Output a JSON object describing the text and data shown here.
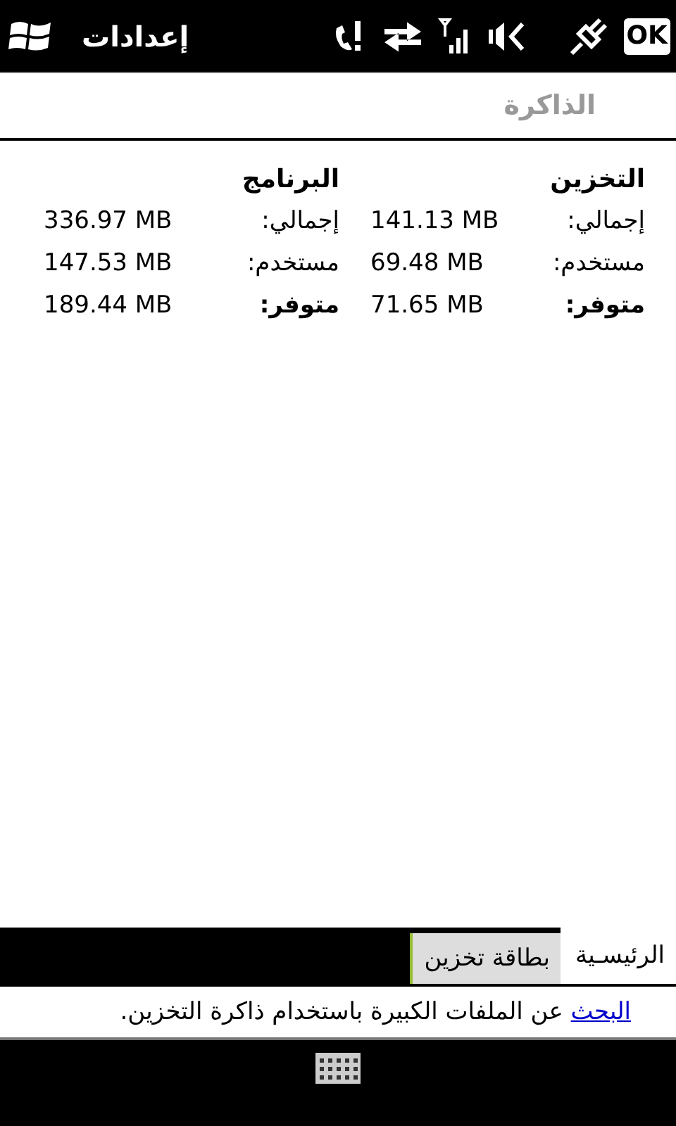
{
  "title_bar": {
    "title": "إعدادات",
    "ok_label": "OK"
  },
  "page_title": "الذاكرة",
  "columns": [
    {
      "heading": "التخزين",
      "rows": [
        {
          "label": "إجمالي:",
          "value": "141.13 MB",
          "emphasized": false
        },
        {
          "label": "مستخدم:",
          "value": "69.48 MB",
          "emphasized": false
        },
        {
          "label": "متوفر:",
          "value": "71.65 MB",
          "emphasized": true
        }
      ]
    },
    {
      "heading": "البرنامج",
      "rows": [
        {
          "label": "إجمالي:",
          "value": "336.97 MB",
          "emphasized": false
        },
        {
          "label": "مستخدم:",
          "value": "147.53 MB",
          "emphasized": false
        },
        {
          "label": "متوفر:",
          "value": "189.44 MB",
          "emphasized": true
        }
      ]
    }
  ],
  "tabs": [
    {
      "label": "الرئيسـية",
      "selected": true
    },
    {
      "label": "بطاقة تخزين",
      "selected": false
    }
  ],
  "footer": {
    "link": "البحث",
    "text": " عن الملفات الكبيرة باستخدام ذاكرة التخزين."
  }
}
